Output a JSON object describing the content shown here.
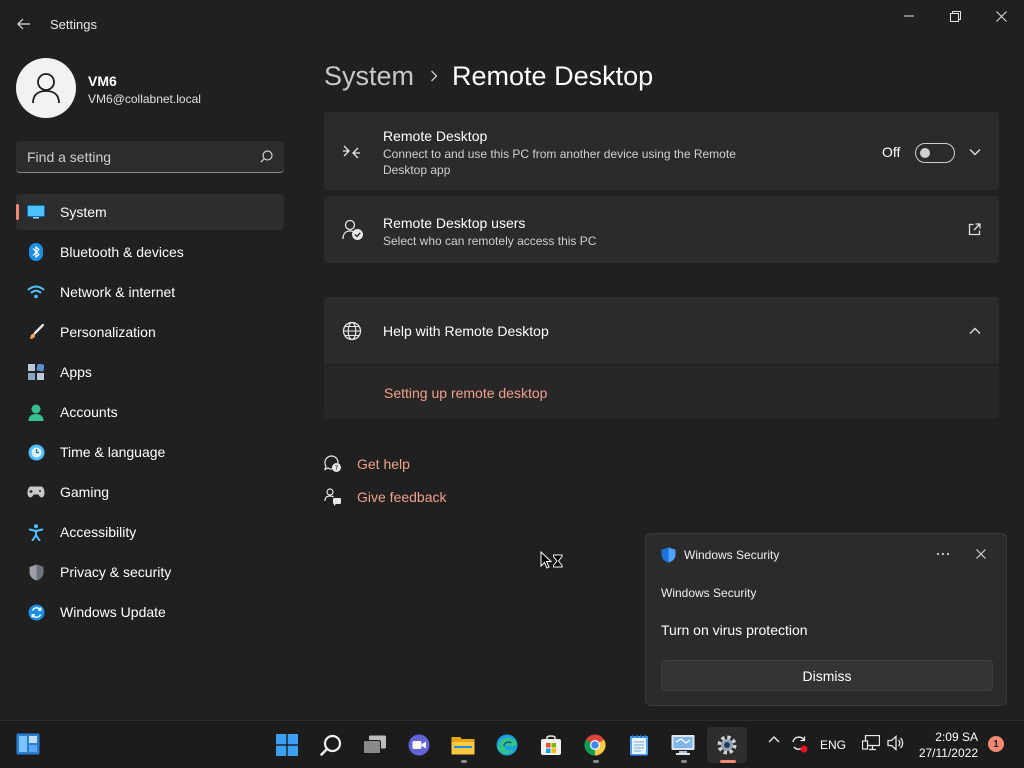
{
  "window": {
    "title": "Settings"
  },
  "user": {
    "name": "VM6",
    "email": "VM6@collabnet.local"
  },
  "search": {
    "placeholder": "Find a setting"
  },
  "sidebar": {
    "items": [
      {
        "label": "System",
        "icon": "monitor-icon",
        "active": true
      },
      {
        "label": "Bluetooth & devices",
        "icon": "bluetooth-icon"
      },
      {
        "label": "Network & internet",
        "icon": "wifi-icon"
      },
      {
        "label": "Personalization",
        "icon": "brush-icon"
      },
      {
        "label": "Apps",
        "icon": "apps-icon"
      },
      {
        "label": "Accounts",
        "icon": "person-icon"
      },
      {
        "label": "Time & language",
        "icon": "clock-globe-icon"
      },
      {
        "label": "Gaming",
        "icon": "gamepad-icon"
      },
      {
        "label": "Accessibility",
        "icon": "accessibility-icon"
      },
      {
        "label": "Privacy & security",
        "icon": "shield-icon"
      },
      {
        "label": "Windows Update",
        "icon": "update-icon"
      }
    ]
  },
  "breadcrumb": {
    "parent": "System",
    "current": "Remote Desktop"
  },
  "remote_desktop": {
    "title": "Remote Desktop",
    "description": "Connect to and use this PC from another device using the Remote Desktop app",
    "toggle_label": "Off",
    "toggle_on": false
  },
  "remote_users": {
    "title": "Remote Desktop users",
    "description": "Select who can remotely access this PC"
  },
  "help": {
    "title": "Help with Remote Desktop",
    "link": "Setting up remote desktop"
  },
  "links": {
    "get_help": "Get help",
    "give_feedback": "Give feedback"
  },
  "toast": {
    "app": "Windows Security",
    "heading": "Windows Security",
    "body": "Turn on virus protection",
    "button": "Dismiss"
  },
  "taskbar": {
    "apps": [
      "start-icon",
      "search-icon",
      "task-view-icon",
      "teams-chat-icon",
      "file-explorer-icon",
      "edge-icon",
      "store-icon",
      "chrome-icon",
      "notepad-icon",
      "remote-desktop-icon",
      "settings-icon"
    ],
    "language": "ENG",
    "time": "2:09 SA",
    "date": "27/11/2022",
    "notifications": "1"
  },
  "colors": {
    "accent": "#f08a73",
    "background": "#202020",
    "card": "#2b2b2b"
  }
}
